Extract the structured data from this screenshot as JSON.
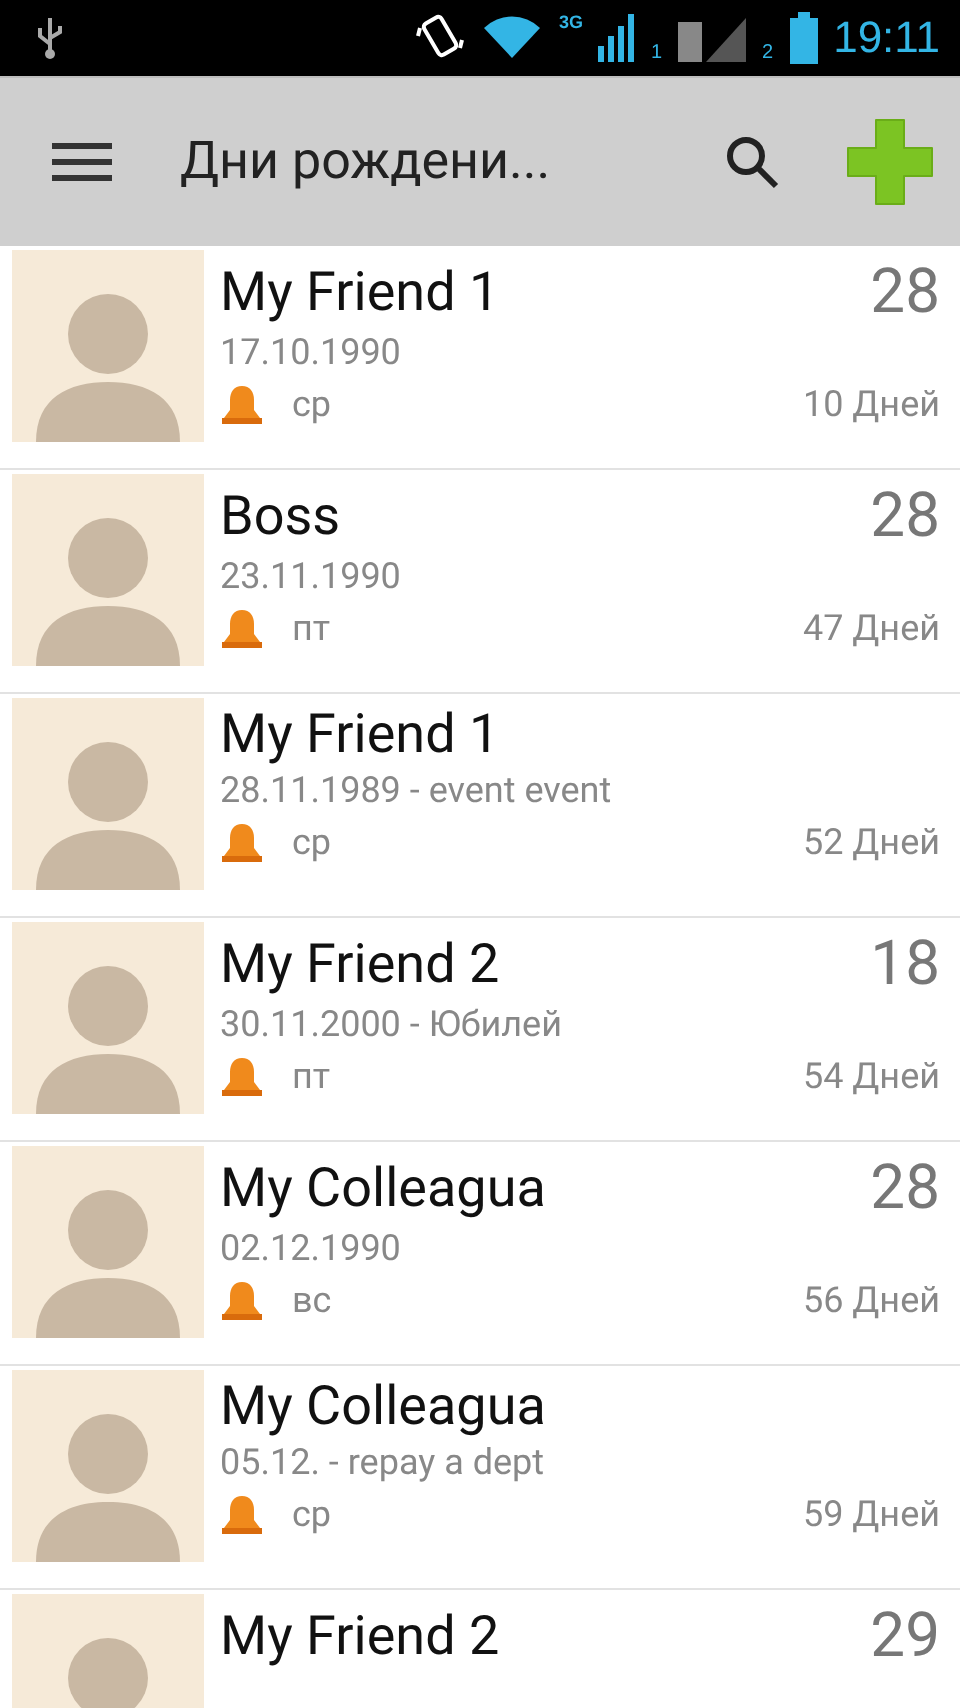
{
  "status_bar": {
    "signal_label": "3G",
    "sim1": "1",
    "sim2": "2",
    "time": "19:11"
  },
  "action_bar": {
    "title": "Дни рождени..."
  },
  "rows": [
    {
      "name": "My Friend 1",
      "date": "17.10.1990",
      "weekday": "ср",
      "age": "28",
      "days": "10 Дней"
    },
    {
      "name": "Boss",
      "date": "23.11.1990",
      "weekday": "пт",
      "age": "28",
      "days": "47 Дней"
    },
    {
      "name": "My Friend 1",
      "date": "28.11.1989 - event event",
      "weekday": "ср",
      "days": "52 Дней"
    },
    {
      "name": "My Friend 2",
      "date": "30.11.2000 - Юбилей",
      "weekday": "пт",
      "age": "18",
      "days": "54 Дней"
    },
    {
      "name": "My Colleagua",
      "date": "02.12.1990",
      "weekday": "вс",
      "age": "28",
      "days": "56 Дней"
    },
    {
      "name": "My Colleagua",
      "date": "05.12. - repay a dept",
      "weekday": "ср",
      "days": "59 Дней"
    },
    {
      "name": "My Friend 2",
      "age": "29"
    }
  ]
}
